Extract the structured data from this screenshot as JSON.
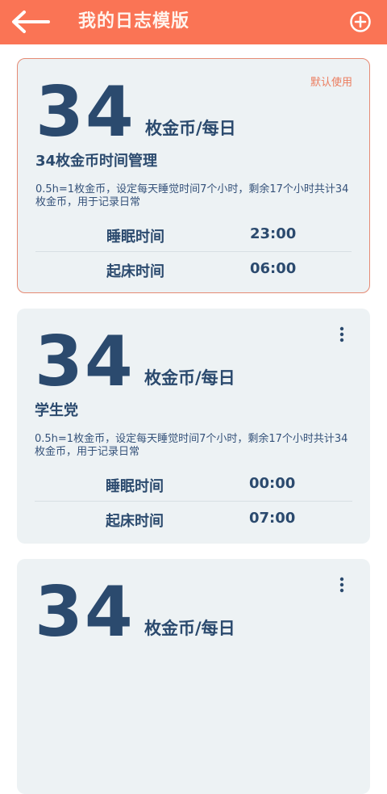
{
  "header": {
    "title": "我的日志模版"
  },
  "templates": [
    {
      "badge": "默认使用",
      "coins": "34",
      "unit": "枚金币/每日",
      "name": "34枚金币时间管理",
      "desc": "0.5h=1枚金币，设定每天睡觉时间7个小时，剩余17个小时共计34枚金币，用于记录日常",
      "sleep_label": "睡眠时间",
      "sleep_time": "23:00",
      "wake_label": "起床时间",
      "wake_time": "06:00"
    },
    {
      "coins": "34",
      "unit": "枚金币/每日",
      "name": "学生党",
      "desc": "0.5h=1枚金币，设定每天睡觉时间7个小时，剩余17个小时共计34枚金币，用于记录日常",
      "sleep_label": "睡眠时间",
      "sleep_time": "00:00",
      "wake_label": "起床时间",
      "wake_time": "07:00"
    },
    {
      "coins": "34",
      "unit": "枚金币/每日"
    }
  ]
}
